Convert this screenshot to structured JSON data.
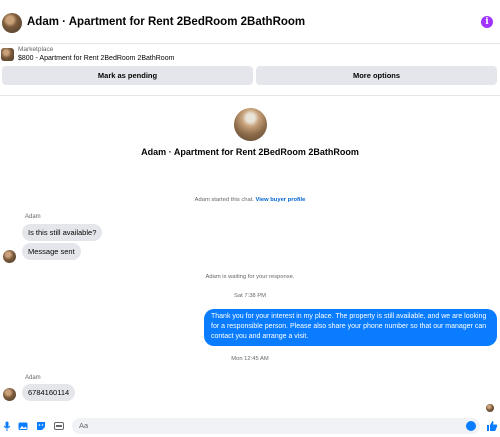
{
  "header": {
    "title": "Adam · Apartment for Rent 2BedRoom 2BathRoom",
    "info_icon": "info-icon",
    "accent": "#a033ff"
  },
  "marketplace": {
    "label": "Marketplace",
    "item": "$800 - Apartment for Rent 2BedRoom 2BathRoom",
    "pending_button": "Mark as pending",
    "more_button": "More options"
  },
  "profile": {
    "name": "Adam · Apartment for Rent 2BedRoom 2BathRoom"
  },
  "conversation": {
    "started_text": "Adam started this chat.",
    "view_profile_link": "View buyer profile",
    "sender_1": "Adam",
    "msg_1": "Is this still available?",
    "msg_2": "Message sent",
    "waiting_text": "Adam is waiting for your response.",
    "time_1": "Sat 7:38 PM",
    "outgoing": "Thank you for your interest in my place. The property is still available, and we are looking for a responsible person. Please also share your phone number so that our manager can contact you and arrange a visit.",
    "time_2": "Mon 12:45 AM",
    "sender_2": "Adam",
    "msg_3": "6784160114"
  },
  "composer": {
    "placeholder": "Aa",
    "icons": [
      "microphone-icon",
      "photo-icon",
      "sticker-icon",
      "gif-icon",
      "emoji-icon",
      "like-icon"
    ],
    "accent": "#0a7cff"
  }
}
